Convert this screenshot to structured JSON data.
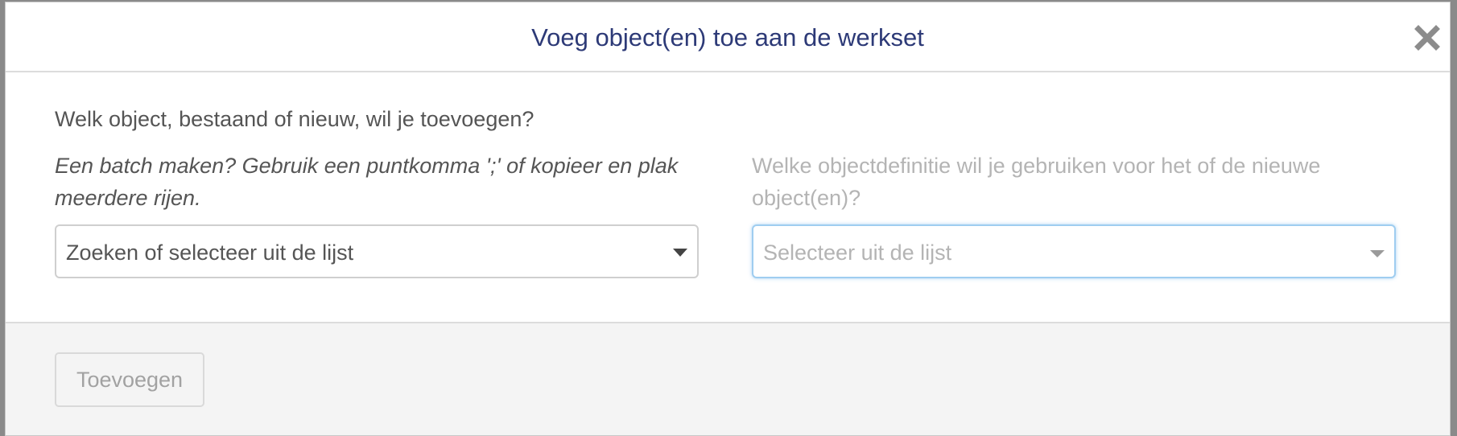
{
  "dialog": {
    "title": "Voeg object(en) toe aan de werkset",
    "close_icon": "close-icon"
  },
  "body": {
    "question": "Welk object, bestaand of nieuw, wil je toevoegen?",
    "batch_hint": "Een batch maken? Gebruik een puntkomma ';' of kopieer en plak meerdere rijen.",
    "definition_hint": "Welke objectdefinitie wil je gebruiken voor het of de nieuwe object(en)?",
    "object_select": {
      "placeholder": "Zoeken of selecteer uit de lijst"
    },
    "definition_select": {
      "placeholder": "Selecteer uit de lijst",
      "state": "focused"
    }
  },
  "footer": {
    "add_button_label": "Toevoegen",
    "add_button_state": "disabled"
  },
  "colors": {
    "title": "#2d3a77",
    "text": "#555555",
    "muted": "#b4b4b4",
    "focus_border": "#9fcdf0",
    "footer_bg": "#f4f4f4"
  }
}
